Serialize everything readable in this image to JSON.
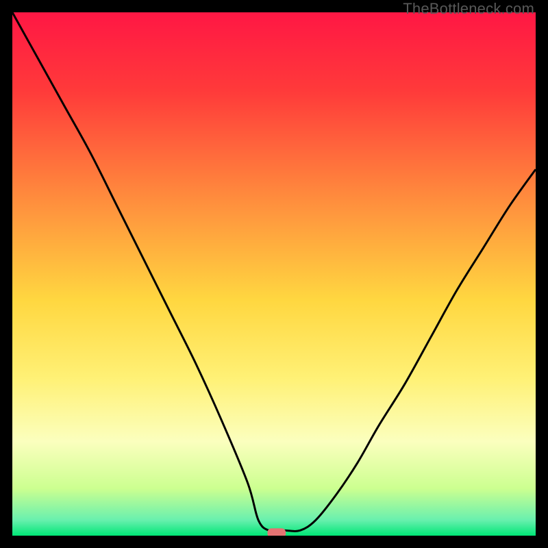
{
  "watermark": "TheBottleneck.com",
  "chart_data": {
    "type": "line",
    "title": "",
    "xlabel": "",
    "ylabel": "",
    "xlim": [
      0,
      100
    ],
    "ylim": [
      0,
      100
    ],
    "gradient_stops": [
      {
        "offset": 0,
        "color": "#ff1744"
      },
      {
        "offset": 15,
        "color": "#ff3a3a"
      },
      {
        "offset": 35,
        "color": "#ff8a3d"
      },
      {
        "offset": 55,
        "color": "#ffd740"
      },
      {
        "offset": 70,
        "color": "#fff176"
      },
      {
        "offset": 82,
        "color": "#fbffbe"
      },
      {
        "offset": 91,
        "color": "#ccff90"
      },
      {
        "offset": 97,
        "color": "#69f0ae"
      },
      {
        "offset": 100,
        "color": "#00e676"
      }
    ],
    "series": [
      {
        "name": "bottleneck-curve",
        "color": "#000000",
        "x": [
          0,
          5,
          10,
          15,
          20,
          25,
          30,
          35,
          40,
          45,
          47,
          49,
          52,
          55,
          58,
          62,
          66,
          70,
          75,
          80,
          85,
          90,
          95,
          100
        ],
        "y": [
          100,
          91,
          82,
          73,
          63,
          53,
          43,
          33,
          22,
          10,
          3,
          1,
          1,
          1,
          3,
          8,
          14,
          21,
          29,
          38,
          47,
          55,
          63,
          70
        ]
      }
    ],
    "marker": {
      "x": 50.5,
      "y": 0.5,
      "color": "#e57373",
      "width": 3.5,
      "height": 1.8
    }
  }
}
